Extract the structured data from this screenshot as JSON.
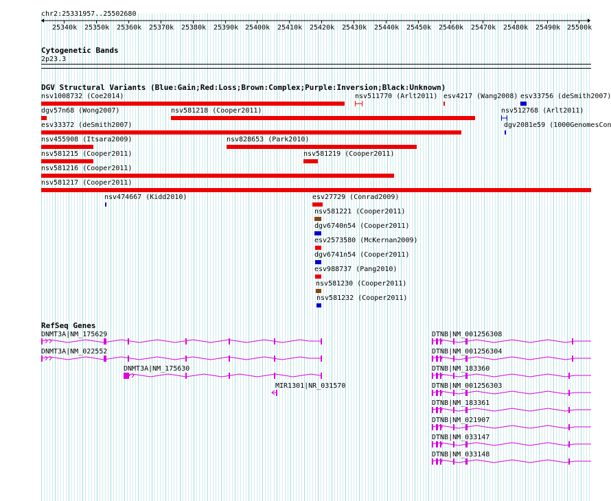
{
  "ruler": {
    "location": "chr2:25331957..25502680",
    "ticks": [
      "25340k",
      "25350k",
      "25360k",
      "25370k",
      "25380k",
      "25390k",
      "25400k",
      "25410k",
      "25420k",
      "25430k",
      "25440k",
      "25450k",
      "25460k",
      "25470k",
      "25480k",
      "25490k",
      "25500k"
    ]
  },
  "cytoband": {
    "title": "Cytogenetic Bands",
    "band": "2p23.3"
  },
  "dgv": {
    "title": "DGV Structural Variants (Blue:Gain;Red:Loss;Brown:Complex;Purple:Inversion;Black:Unknown)",
    "colors": {
      "gain": "#0000cc",
      "loss": "#ee0000",
      "complex": "#8b4513"
    },
    "variants": [
      {
        "label": "nsv1008732 (Coe2014)",
        "type": "loss"
      },
      {
        "label": "nsv511770 (Arlt2011)",
        "type": "loss"
      },
      {
        "label": "esv4217 (Wang2008)",
        "type": "loss"
      },
      {
        "label": "esv33756 (deSmith2007)",
        "type": "gain"
      },
      {
        "label": "dgv57n68 (Wong2007)",
        "type": "loss"
      },
      {
        "label": "nsv581218 (Cooper2011)",
        "type": "loss"
      },
      {
        "label": "nsv512768 (Arlt2011)",
        "type": "gain"
      },
      {
        "label": "esv33372 (deSmith2007)",
        "type": "loss"
      },
      {
        "label": "dgv2081e59 (1000GenomesCon",
        "type": "gain"
      },
      {
        "label": "nsv455908 (Itsara2009)",
        "type": "loss"
      },
      {
        "label": "nsv828653 (Park2010)",
        "type": "loss"
      },
      {
        "label": "nsv581215 (Cooper2011)",
        "type": "loss"
      },
      {
        "label": "nsv581219 (Cooper2011)",
        "type": "loss"
      },
      {
        "label": "nsv581216 (Cooper2011)",
        "type": "loss"
      },
      {
        "label": "nsv581217 (Cooper2011)",
        "type": "loss"
      },
      {
        "label": "nsv474667 (Kidd2010)",
        "type": "gain"
      },
      {
        "label": "esv27729 (Conrad2009)",
        "type": "loss"
      },
      {
        "label": "nsv581221 (Cooper2011)",
        "type": "complex"
      },
      {
        "label": "dgv6740n54 (Cooper2011)",
        "type": "gain"
      },
      {
        "label": "esv2573580 (McKernan2009)",
        "type": "loss"
      },
      {
        "label": "dgv6741n54 (Cooper2011)",
        "type": "gain"
      },
      {
        "label": "esv988737 (Pang2010)",
        "type": "loss"
      },
      {
        "label": "nsv581230 (Cooper2011)",
        "type": "complex"
      },
      {
        "label": "nsv581232 (Cooper2011)",
        "type": "gain"
      }
    ]
  },
  "refseq": {
    "title": "RefSeq Genes",
    "color": "#dd00dd",
    "genes": [
      {
        "label": "DNMT3A|NM_175629"
      },
      {
        "label": "DNMT3A|NM_022552"
      },
      {
        "label": "DNMT3A|NM_175630"
      },
      {
        "label": "MIR1301|NR_031570"
      },
      {
        "label": "DTNB|NM_001256308"
      },
      {
        "label": "DTNB|NM_001256304"
      },
      {
        "label": "DTNB|NM_183360"
      },
      {
        "label": "DTNB|NM_001256303"
      },
      {
        "label": "DTNB|NM_183361"
      },
      {
        "label": "DTNB|NM_021907"
      },
      {
        "label": "DTNB|NM_033147"
      },
      {
        "label": "DTNB|NM_033148"
      }
    ]
  }
}
